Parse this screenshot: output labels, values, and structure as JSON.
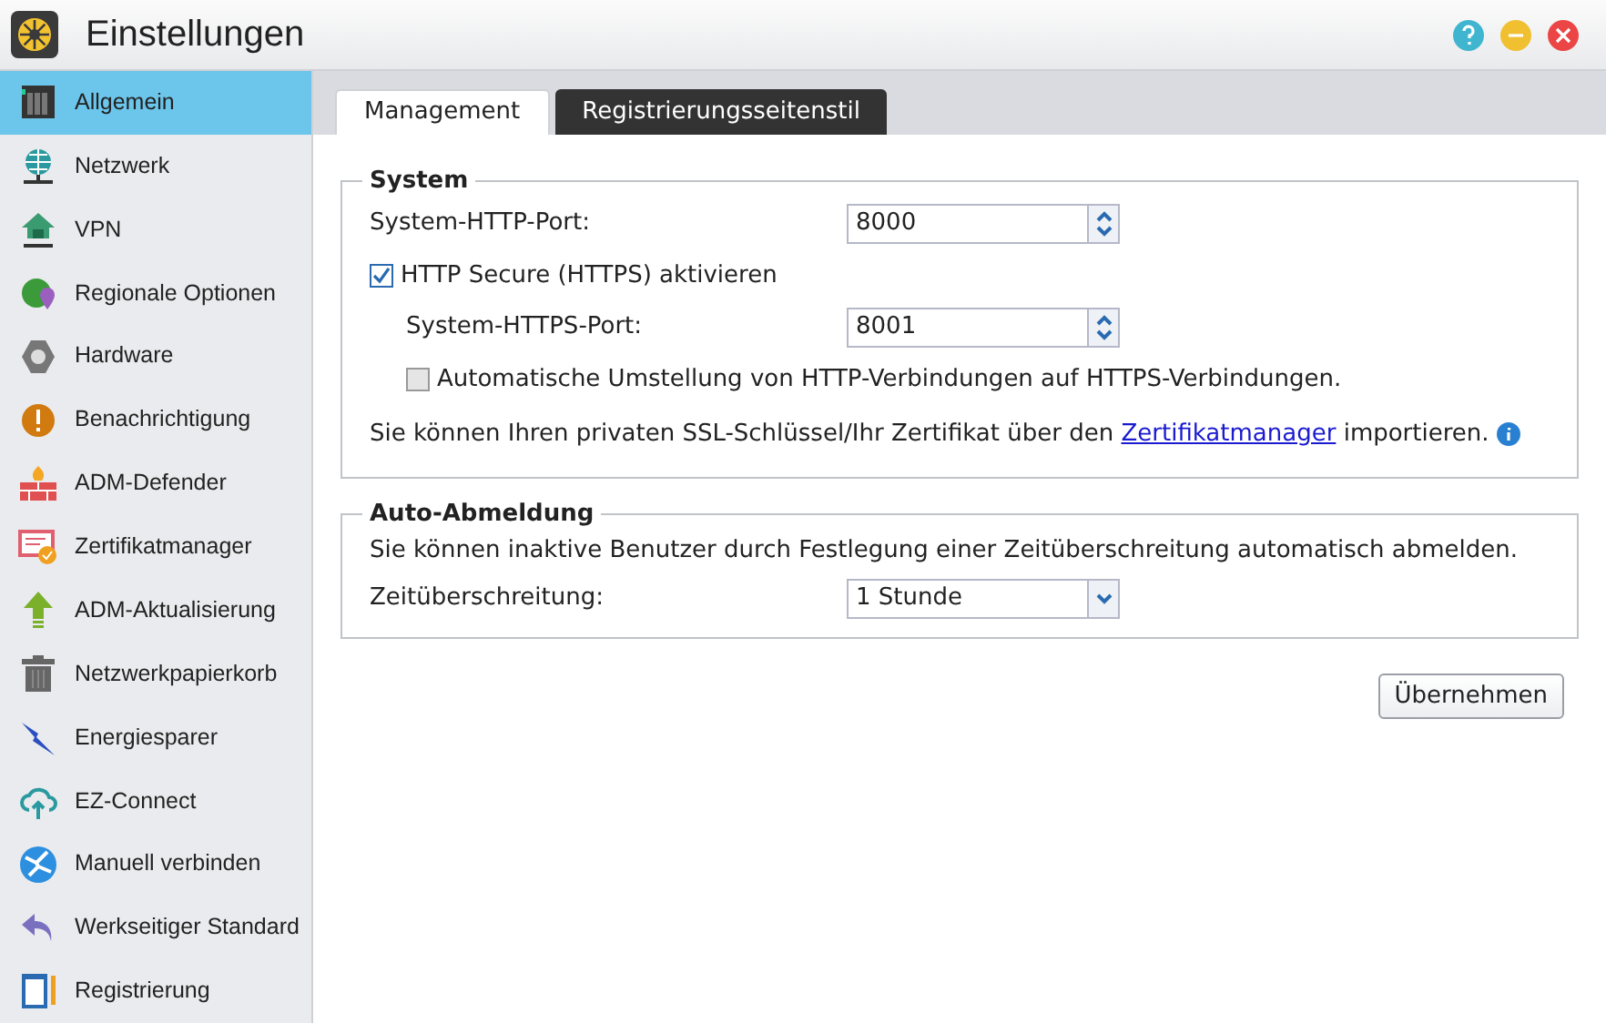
{
  "window": {
    "title": "Einstellungen"
  },
  "sidebar": {
    "items": [
      {
        "label": "Allgemein",
        "selected": true
      },
      {
        "label": "Netzwerk",
        "selected": false
      },
      {
        "label": "VPN",
        "selected": false
      },
      {
        "label": "Regionale Optionen",
        "selected": false
      },
      {
        "label": "Hardware",
        "selected": false
      },
      {
        "label": "Benachrichtigung",
        "selected": false
      },
      {
        "label": "ADM-Defender",
        "selected": false
      },
      {
        "label": "Zertifikatmanager",
        "selected": false
      },
      {
        "label": "ADM-Aktualisierung",
        "selected": false
      },
      {
        "label": "Netzwerkpapierkorb",
        "selected": false
      },
      {
        "label": "Energiesparer",
        "selected": false
      },
      {
        "label": "EZ-Connect",
        "selected": false
      },
      {
        "label": "Manuell verbinden",
        "selected": false
      },
      {
        "label": "Werkseitiger Standard",
        "selected": false
      },
      {
        "label": "Registrierung",
        "selected": false
      }
    ]
  },
  "tabs": [
    {
      "label": "Management",
      "selected": true
    },
    {
      "label": "Registrierungsseitenstil",
      "selected": false
    }
  ],
  "system": {
    "legend": "System",
    "rows": [
      {
        "kind": "spinner",
        "label": "System-HTTP-Port:",
        "value": "8000",
        "indent": false
      },
      {
        "kind": "checkbox",
        "label": "HTTP Secure (HTTPS) aktivieren",
        "checked": true,
        "indent": false
      },
      {
        "kind": "spinner",
        "label": "System-HTTPS-Port:",
        "value": "8001",
        "indent": true
      },
      {
        "kind": "checkbox",
        "label": "Automatische Umstellung von HTTP-Verbindungen auf HTTPS-Verbindungen.",
        "checked": false,
        "indent": true
      }
    ],
    "note": {
      "before": "Sie können Ihren privaten SSL-Schlüssel/Ihr Zertifikat über den",
      "link": "Zertifikatmanager",
      "after": "importieren."
    }
  },
  "auto_logout": {
    "legend": "Auto-Abmeldung",
    "description": "Sie können inaktive Benutzer durch Festlegung einer Zeitüberschreitung automatisch abmelden.",
    "timeout_label": "Zeitüberschreitung:",
    "timeout_value": "1 Stunde"
  },
  "apply_button": "Übernehmen"
}
